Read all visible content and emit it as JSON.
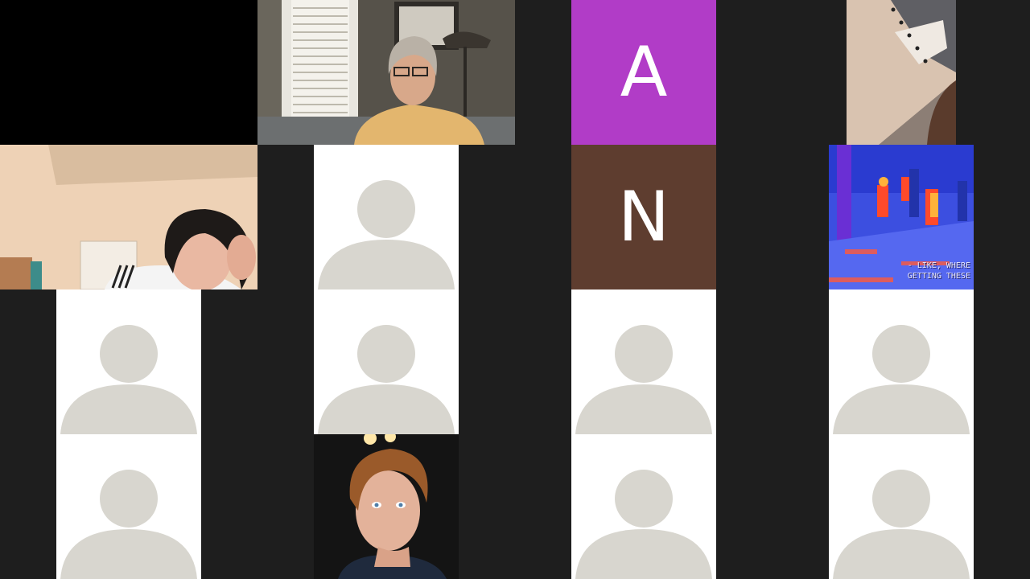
{
  "gallery": {
    "background": "#1e1e1e",
    "avatar_color": "#d8d6cf",
    "tiles": [
      {
        "kind": "video-off",
        "participant": "",
        "description": ""
      },
      {
        "kind": "video",
        "scene": "woman-living-room"
      },
      {
        "kind": "initial",
        "initial": "A",
        "color": "#b13cc7"
      },
      {
        "kind": "video",
        "scene": "ceiling-camera"
      },
      {
        "kind": "video",
        "scene": "girl-bedroom"
      },
      {
        "kind": "avatar"
      },
      {
        "kind": "initial",
        "initial": "N",
        "color": "#5e3d2f"
      },
      {
        "kind": "video",
        "scene": "inverted-color-video",
        "caption_lines": [
          "- LIKE, WHERE",
          "GETTING THESE"
        ]
      },
      {
        "kind": "avatar"
      },
      {
        "kind": "avatar"
      },
      {
        "kind": "avatar"
      },
      {
        "kind": "avatar"
      },
      {
        "kind": "avatar"
      },
      {
        "kind": "video",
        "scene": "boy-portrait"
      },
      {
        "kind": "avatar"
      },
      {
        "kind": "avatar"
      }
    ]
  }
}
